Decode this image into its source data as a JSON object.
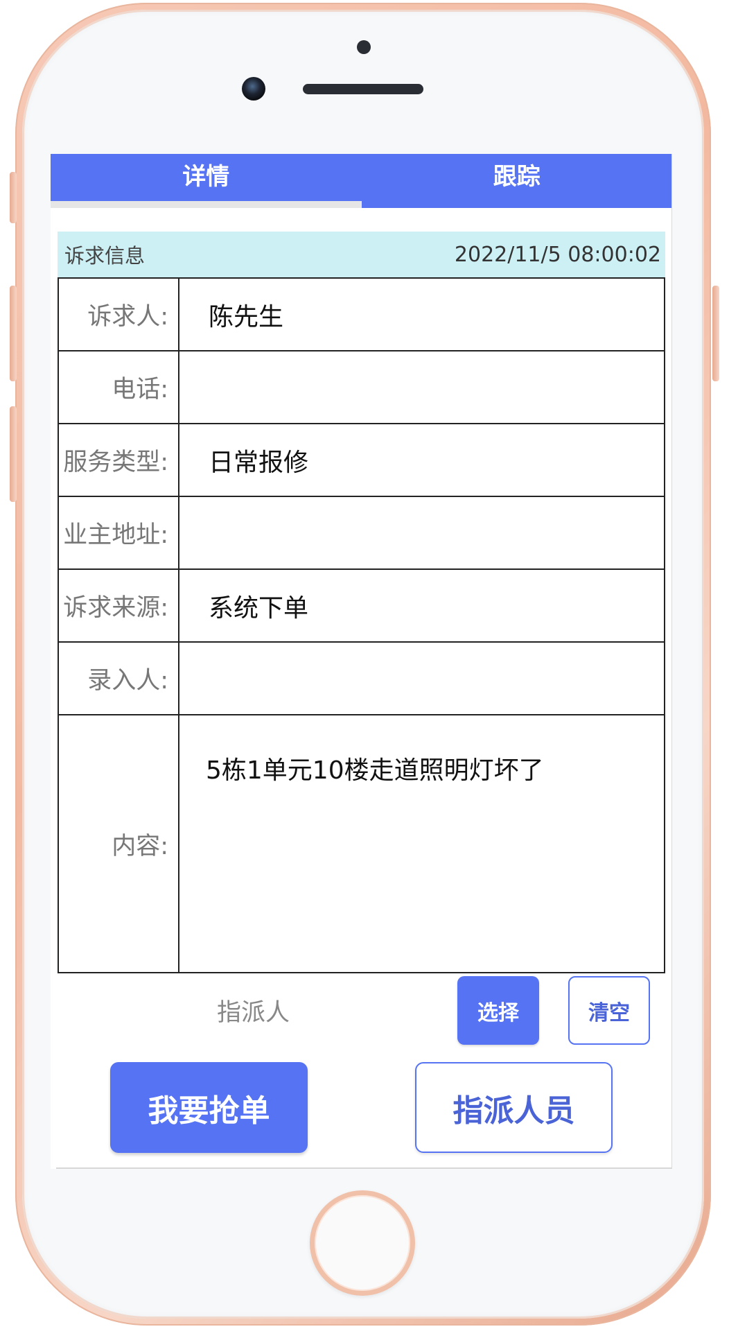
{
  "tabs": [
    {
      "label": "详情",
      "active": true
    },
    {
      "label": "跟踪",
      "active": false
    }
  ],
  "info": {
    "title": "诉求信息",
    "timestamp": "2022/11/5 08:00:02"
  },
  "fields": [
    {
      "label": "诉求人:",
      "value": "陈先生"
    },
    {
      "label": "电话:",
      "value": ""
    },
    {
      "label": "服务类型:",
      "value": "日常报修"
    },
    {
      "label": "业主地址:",
      "value": ""
    },
    {
      "label": "诉求来源:",
      "value": "系统下单"
    },
    {
      "label": "录入人:",
      "value": ""
    },
    {
      "label": "内容:",
      "value": "5栋1单元10楼走道照明灯坏了"
    }
  ],
  "assign": {
    "label": "指派人",
    "select_label": "选择",
    "clear_label": "清空"
  },
  "actions": {
    "grab_label": "我要抢单",
    "assign_label": "指派人员"
  },
  "colors": {
    "primary": "#5573f2",
    "info_bar": "#cdf0f5",
    "phone_frame": "#f3b9a0"
  }
}
